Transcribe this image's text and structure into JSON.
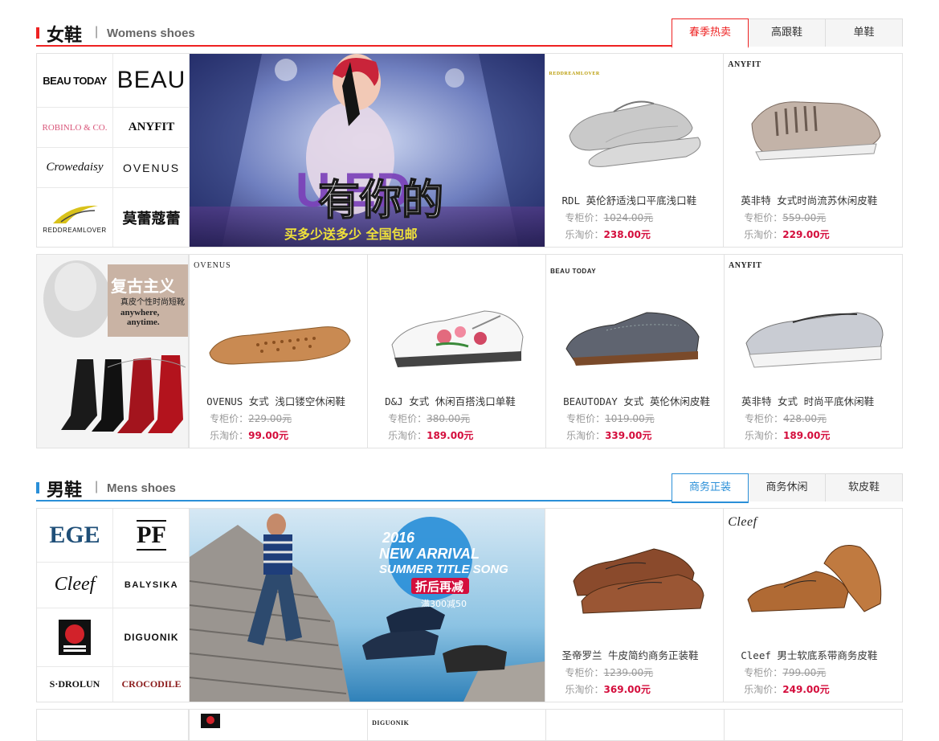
{
  "women": {
    "title_cn": "女鞋",
    "sep": "|",
    "title_en": "Womens shoes",
    "tabs": [
      "春季热卖",
      "高跟鞋",
      "单鞋"
    ],
    "brands": [
      "BEAU TODAY",
      "BEAU",
      "ROBINLO & CO.",
      "ANYFIT",
      "Crowedaisy",
      "OVENUS",
      "REDDREAMLOVER",
      "莫蕾蔻蕾"
    ],
    "banner": {
      "big": "有你的",
      "slogan": "买多少送多少 全国包邮",
      "letters": "U   ED"
    },
    "vintage": {
      "title": "复古主义",
      "sub": "真皮个性时尚短靴",
      "en1": "anywhere,",
      "en2": "anytime."
    },
    "row1": [
      {
        "logo": "REDDREAMLOVER",
        "name": "RDL 英伦舒适浅口平底浅口鞋",
        "orig_label": "专柜价：",
        "orig": "1024.00元",
        "now_label": "乐淘价：",
        "now": "238.00元"
      },
      {
        "logo": "ANYFIT",
        "name": "英非特 女式时尚流苏休闲皮鞋",
        "orig_label": "专柜价：",
        "orig": "559.00元",
        "now_label": "乐淘价：",
        "now": "229.00元"
      }
    ],
    "row2": [
      {
        "logo": "OVENUS",
        "name": "OVENUS 女式 浅口镂空休闲鞋",
        "orig_label": "专柜价：",
        "orig": "229.00元",
        "now_label": "乐淘价：",
        "now": "99.00元"
      },
      {
        "logo": "",
        "name": "D&J 女式 休闲百搭浅口单鞋",
        "orig_label": "专柜价：",
        "orig": "380.00元",
        "now_label": "乐淘价：",
        "now": "189.00元"
      },
      {
        "logo": "BEAU TODAY",
        "name": "BEAUTODAY 女式 英伦休闲皮鞋",
        "orig_label": "专柜价：",
        "orig": "1019.00元",
        "now_label": "乐淘价：",
        "now": "339.00元"
      },
      {
        "logo": "ANYFIT",
        "name": "英非特 女式 时尚平底休闲鞋",
        "orig_label": "专柜价：",
        "orig": "428.00元",
        "now_label": "乐淘价：",
        "now": "189.00元"
      }
    ]
  },
  "men": {
    "title_cn": "男鞋",
    "sep": "|",
    "title_en": "Mens shoes",
    "tabs": [
      "商务正装",
      "商务休闲",
      "软皮鞋"
    ],
    "brands": [
      "EGE",
      "PF",
      "Cleef",
      "BALYSIKA",
      "",
      "DIGUONIK",
      "S·DROLUN",
      "CROCODILE"
    ],
    "banner": {
      "line1": "2016",
      "line2": "NEW ARRIVAL",
      "line3": "SUMMER TITLE SONG",
      "line4": "折后再减",
      "line5": "满300减50"
    },
    "row1": [
      {
        "logo": "",
        "name": "圣帝罗兰 牛皮简约商务正装鞋",
        "orig_label": "专柜价：",
        "orig": "1239.00元",
        "now_label": "乐淘价：",
        "now": "369.00元"
      },
      {
        "logo": "Cleef",
        "name": "Cleef 男士软底系带商务皮鞋",
        "orig_label": "专柜价：",
        "orig": "799.00元",
        "now_label": "乐淘价：",
        "now": "249.00元"
      }
    ],
    "row2_logos": [
      "",
      "DIGUONIK"
    ]
  },
  "colors": {
    "red": "#e22222",
    "blue": "#2a8fd8",
    "price": "#d40d3c"
  }
}
